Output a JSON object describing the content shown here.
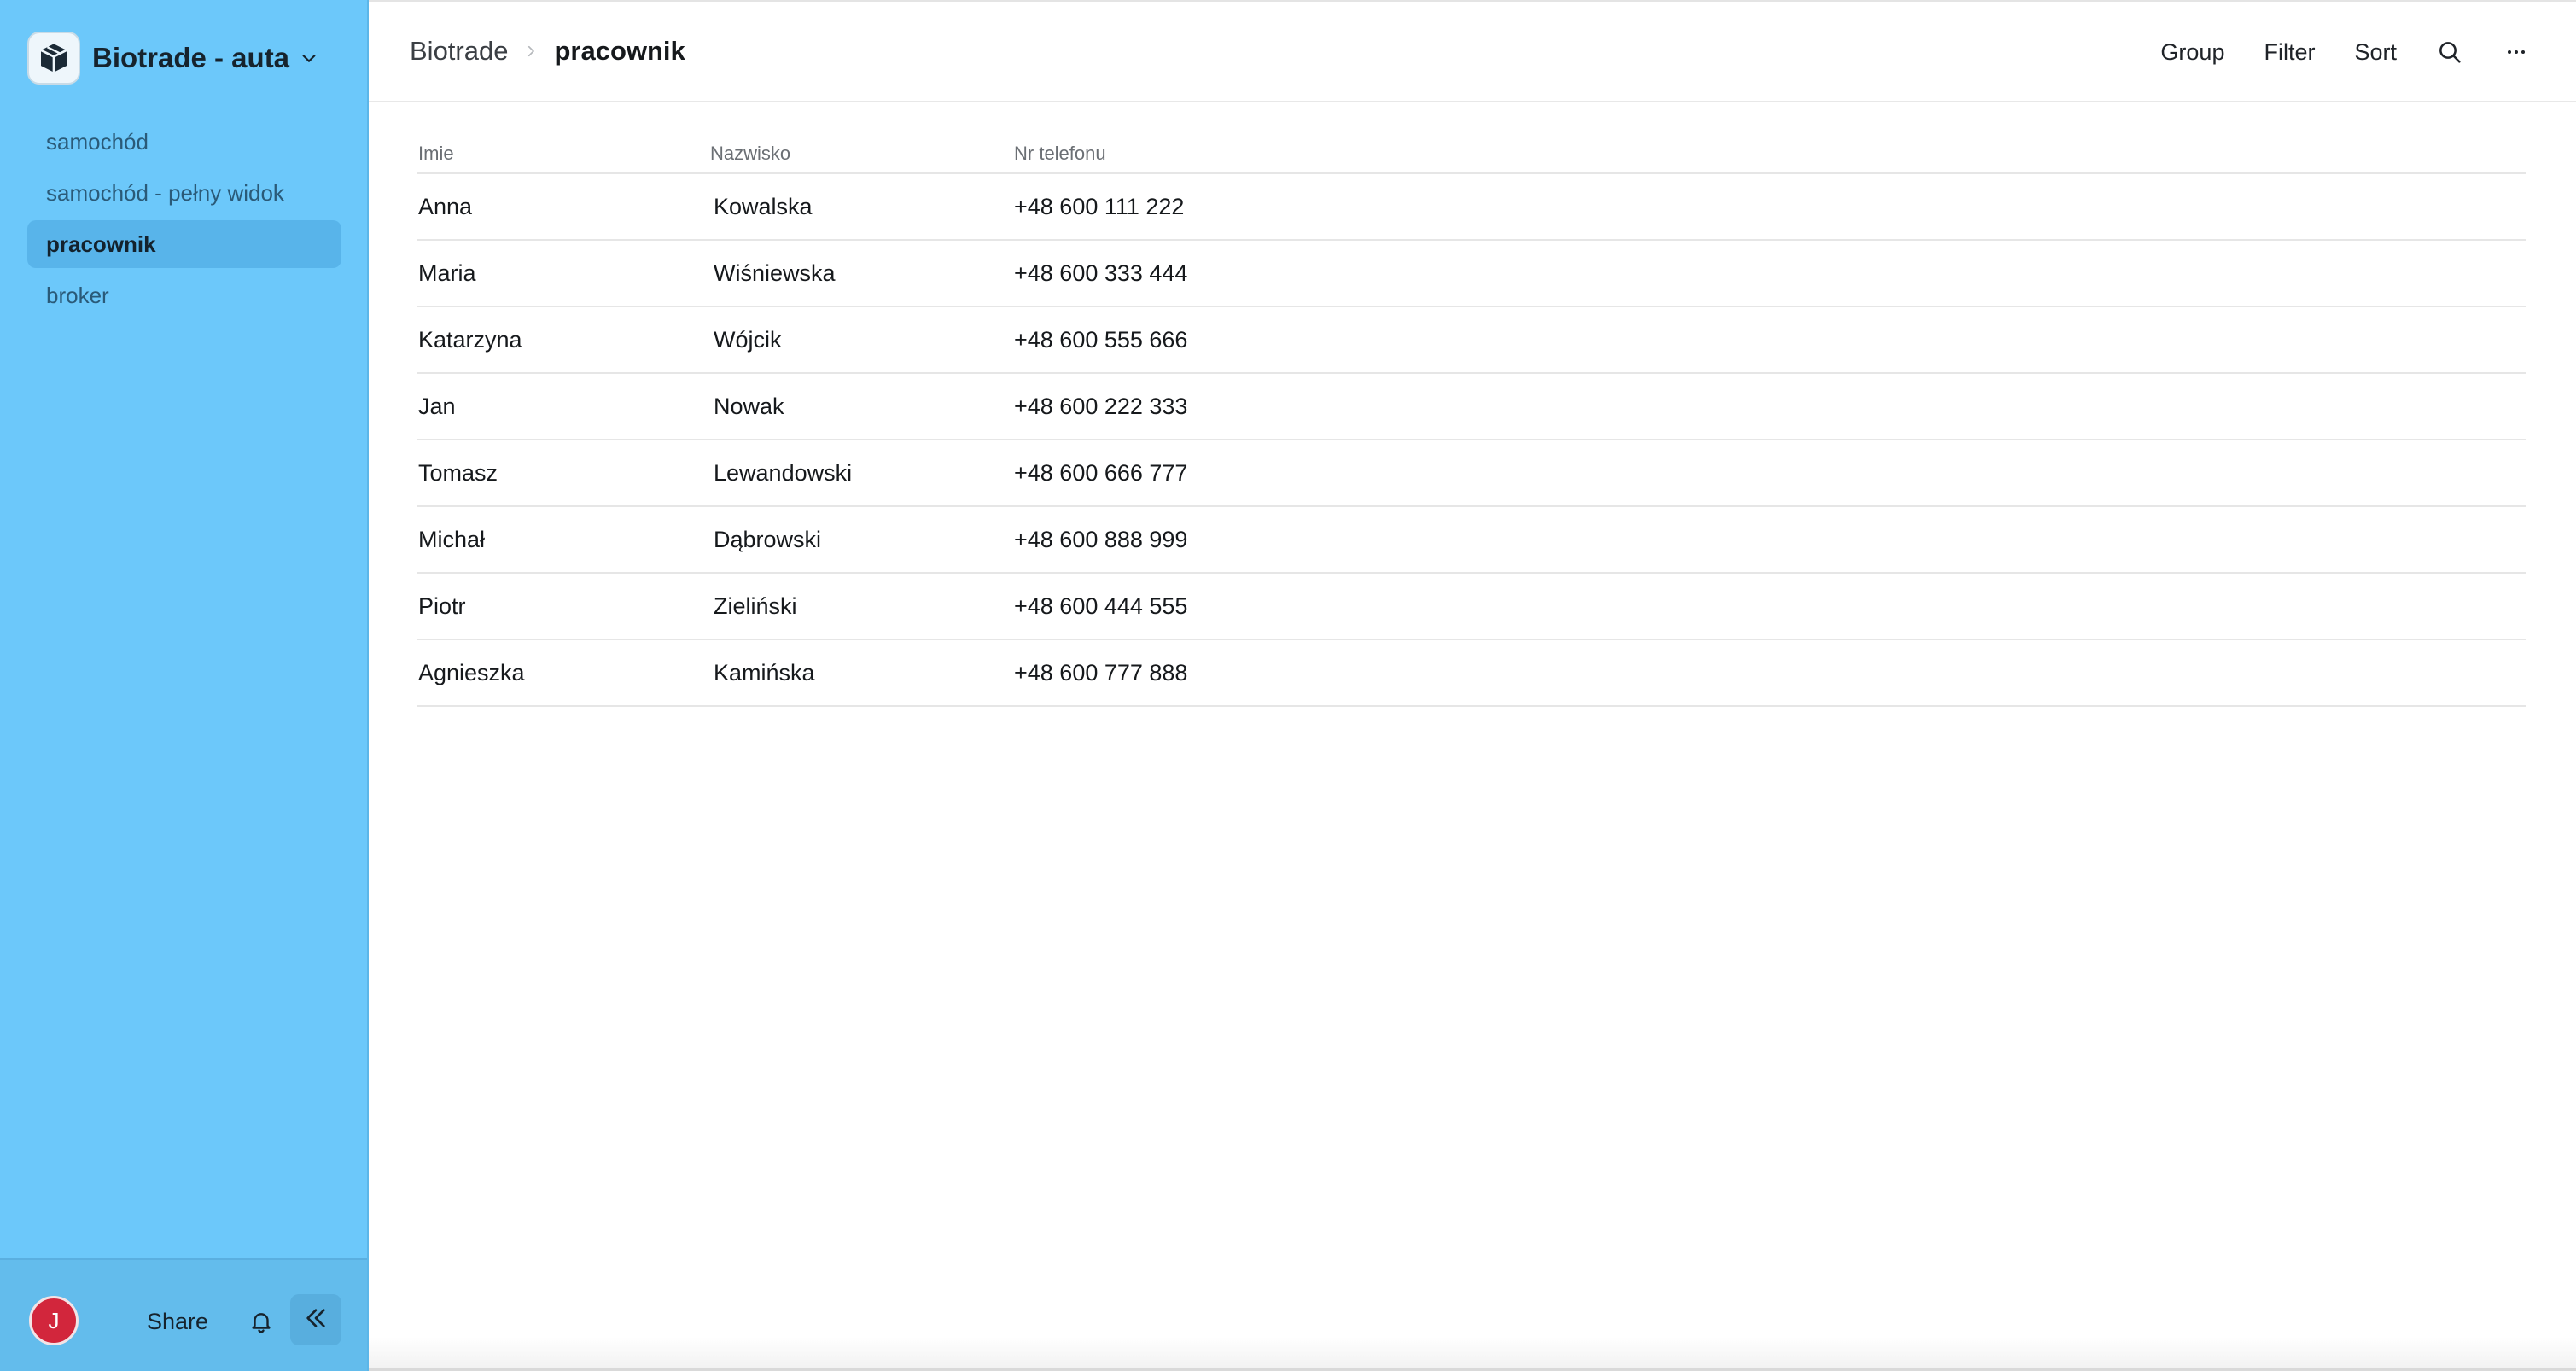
{
  "workspace": {
    "name": "Biotrade - auta",
    "logo_icon": "box-icon"
  },
  "sidebar": {
    "items": [
      {
        "label": "samochód",
        "active": false
      },
      {
        "label": "samochód - pełny widok",
        "active": false
      },
      {
        "label": "pracownik",
        "active": true
      },
      {
        "label": "broker",
        "active": false
      }
    ],
    "footer": {
      "avatar_initial": "J",
      "avatar_color": "#d2263c",
      "share_label": "Share",
      "bell_icon": "bell-icon",
      "collapse_icon": "double-chevron-left-icon"
    }
  },
  "header": {
    "breadcrumb_root": "Biotrade",
    "breadcrumb_current": "pracownik",
    "toolbar": {
      "group_label": "Group",
      "filter_label": "Filter",
      "sort_label": "Sort",
      "search_icon": "search-icon",
      "more_icon": "more-horizontal-icon"
    }
  },
  "table": {
    "columns": [
      "Imie",
      "Nazwisko",
      "Nr telefonu"
    ],
    "rows": [
      [
        "Anna",
        "Kowalska",
        "+48 600 111 222"
      ],
      [
        "Maria",
        "Wiśniewska",
        "+48 600 333 444"
      ],
      [
        "Katarzyna",
        "Wójcik",
        "+48 600 555 666"
      ],
      [
        "Jan",
        "Nowak",
        "+48 600 222 333"
      ],
      [
        "Tomasz",
        "Lewandowski",
        "+48 600 666 777"
      ],
      [
        "Michał",
        "Dąbrowski",
        "+48 600 888 999"
      ],
      [
        "Piotr",
        "Zieliński",
        "+48 600 444 555"
      ],
      [
        "Agnieszka",
        "Kamińska",
        "+48 600 777 888"
      ]
    ]
  },
  "colors": {
    "sidebar_bg": "#6cc8fa",
    "sidebar_active": "#58b4ea"
  }
}
